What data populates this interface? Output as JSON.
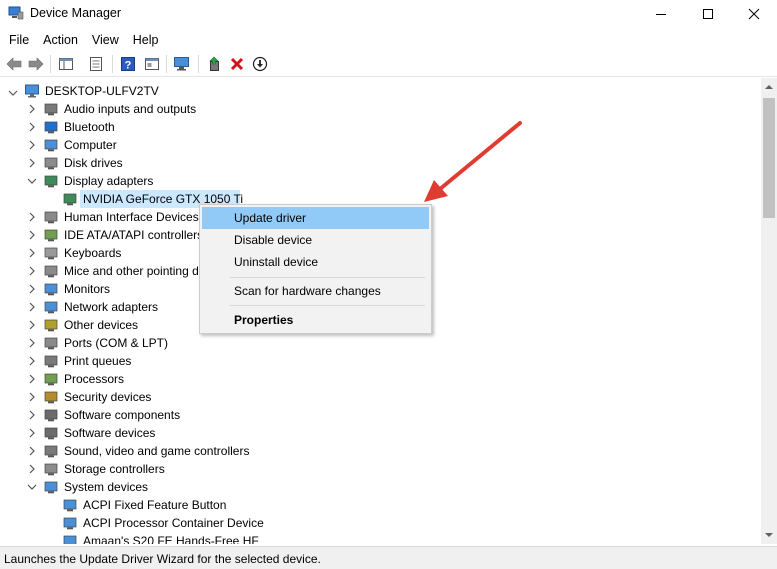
{
  "window": {
    "title": "Device Manager",
    "controls": {
      "minimize": "minimize",
      "maximize": "maximize",
      "close": "close"
    }
  },
  "menubar": {
    "items": [
      "File",
      "Action",
      "View",
      "Help"
    ]
  },
  "toolbar": {
    "buttons": [
      "back-icon",
      "forward-icon",
      "properties-pane-icon",
      "device-list-icon",
      "help-icon",
      "action-view-icon",
      "monitor-scan-icon",
      "add-driver-icon",
      "uninstall-x-icon",
      "download-update-icon"
    ]
  },
  "tree": {
    "root": "DESKTOP-ULFV2TV",
    "items": [
      {
        "label": "Audio inputs and outputs",
        "icon": "speaker-icon",
        "expanded": false,
        "level": 1
      },
      {
        "label": "Bluetooth",
        "icon": "bluetooth-icon",
        "expanded": false,
        "level": 1
      },
      {
        "label": "Computer",
        "icon": "computer-icon",
        "expanded": false,
        "level": 1
      },
      {
        "label": "Disk drives",
        "icon": "disk-drive-icon",
        "expanded": false,
        "level": 1
      },
      {
        "label": "Display adapters",
        "icon": "display-adapter-icon",
        "expanded": true,
        "level": 1
      },
      {
        "label": "NVIDIA GeForce GTX 1050 Ti",
        "icon": "display-adapter-icon",
        "level": 2,
        "selected": true
      },
      {
        "label": "Human Interface Devices",
        "icon": "hid-icon",
        "expanded": false,
        "level": 1
      },
      {
        "label": "IDE ATA/ATAPI controllers",
        "icon": "ide-controller-icon",
        "expanded": false,
        "level": 1
      },
      {
        "label": "Keyboards",
        "icon": "keyboard-icon",
        "expanded": false,
        "level": 1
      },
      {
        "label": "Mice and other pointing d",
        "icon": "mouse-icon",
        "expanded": false,
        "level": 1
      },
      {
        "label": "Monitors",
        "icon": "monitor-icon",
        "expanded": false,
        "level": 1
      },
      {
        "label": "Network adapters",
        "icon": "network-icon",
        "expanded": false,
        "level": 1
      },
      {
        "label": "Other devices",
        "icon": "other-devices-icon",
        "expanded": false,
        "level": 1
      },
      {
        "label": "Ports (COM & LPT)",
        "icon": "port-icon",
        "expanded": false,
        "level": 1
      },
      {
        "label": "Print queues",
        "icon": "printer-icon",
        "expanded": false,
        "level": 1
      },
      {
        "label": "Processors",
        "icon": "processor-icon",
        "expanded": false,
        "level": 1
      },
      {
        "label": "Security devices",
        "icon": "security-icon",
        "expanded": false,
        "level": 1
      },
      {
        "label": "Software components",
        "icon": "software-component-icon",
        "expanded": false,
        "level": 1
      },
      {
        "label": "Software devices",
        "icon": "software-device-icon",
        "expanded": false,
        "level": 1
      },
      {
        "label": "Sound, video and game controllers",
        "icon": "sound-icon",
        "expanded": false,
        "level": 1
      },
      {
        "label": "Storage controllers",
        "icon": "storage-icon",
        "expanded": false,
        "level": 1
      },
      {
        "label": "System devices",
        "icon": "system-devices-icon",
        "expanded": true,
        "level": 1
      },
      {
        "label": "ACPI Fixed Feature Button",
        "icon": "system-device-icon",
        "level": 2
      },
      {
        "label": "ACPI Processor Container Device",
        "icon": "system-device-icon",
        "level": 2
      },
      {
        "label": "Amaan's S20 FE Hands-Free HF",
        "icon": "system-device-icon",
        "level": 2
      }
    ]
  },
  "context_menu": {
    "items": [
      {
        "label": "Update driver",
        "highlighted": true
      },
      {
        "label": "Disable device"
      },
      {
        "label": "Uninstall device"
      },
      {
        "separator": true
      },
      {
        "label": "Scan for hardware changes"
      },
      {
        "separator": true
      },
      {
        "label": "Properties",
        "bold": true
      }
    ]
  },
  "statusbar": {
    "text": "Launches the Update Driver Wizard for the selected device."
  },
  "colors": {
    "selection": "#cce8ff",
    "menu_highlight": "#91c9f7",
    "arrow": "#e03c31"
  }
}
